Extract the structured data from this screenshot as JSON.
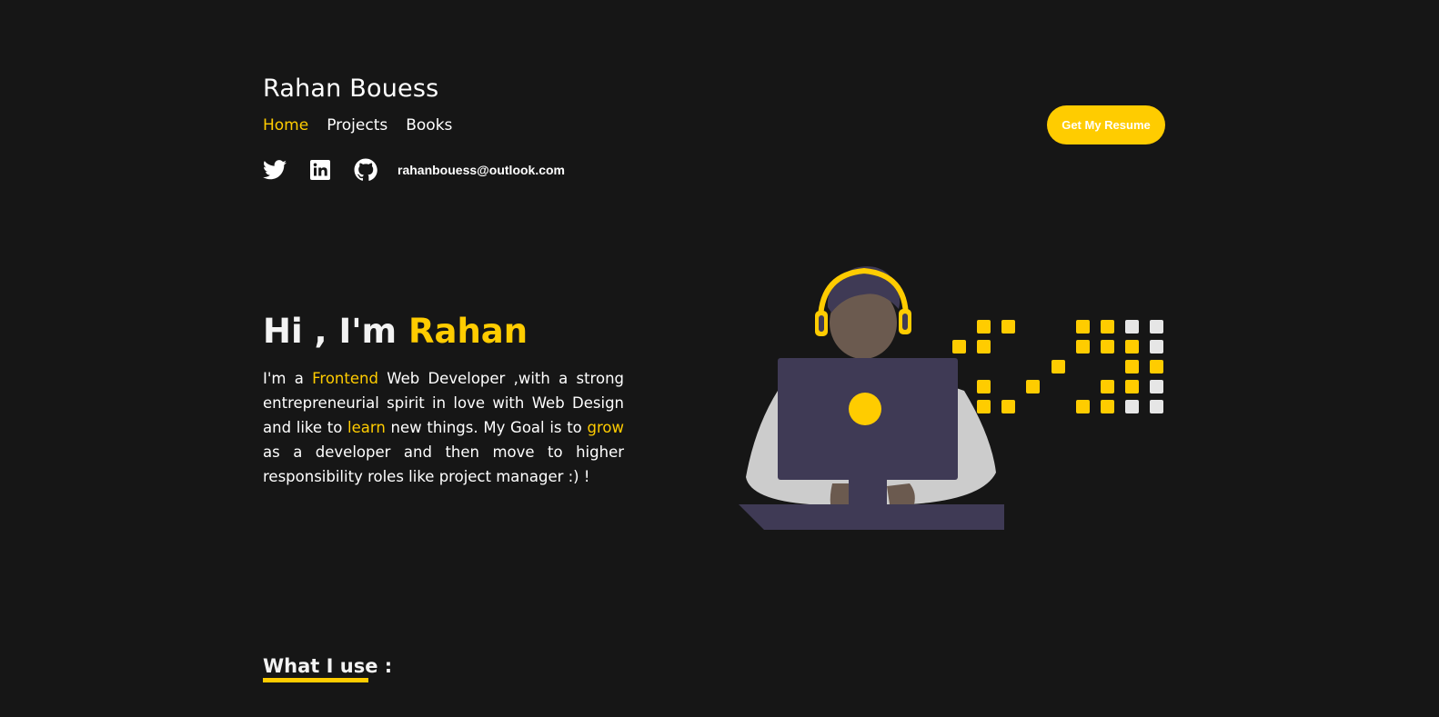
{
  "header": {
    "site_name": "Rahan Bouess",
    "nav": [
      {
        "label": "Home",
        "active": true
      },
      {
        "label": "Projects",
        "active": false
      },
      {
        "label": "Books",
        "active": false
      }
    ],
    "resume_button": "Get My Resume",
    "socials": [
      {
        "icon": "twitter-icon"
      },
      {
        "icon": "linkedin-icon"
      },
      {
        "icon": "github-icon"
      }
    ],
    "email": "rahanbouess@outlook.com"
  },
  "hero": {
    "greeting": "Hi , I'm ",
    "name": "Rahan",
    "text_parts": [
      {
        "text": "I'm a ",
        "highlight": false
      },
      {
        "text": "Frontend",
        "highlight": true
      },
      {
        "text": " Web Developer ,with a strong entrepreneurial spirit in love with Web Design and like to ",
        "highlight": false
      },
      {
        "text": "learn",
        "highlight": true
      },
      {
        "text": " new things. My Goal is to ",
        "highlight": false
      },
      {
        "text": "grow",
        "highlight": true
      },
      {
        "text": " as a developer and then move to higher responsibility roles like project manager :) !",
        "highlight": false
      }
    ],
    "illustration": "developer-with-headphones-illustration"
  },
  "section": {
    "title": "What I use :"
  },
  "colors": {
    "background": "#161616",
    "accent": "#ffcc00",
    "text": "#ffffff"
  }
}
